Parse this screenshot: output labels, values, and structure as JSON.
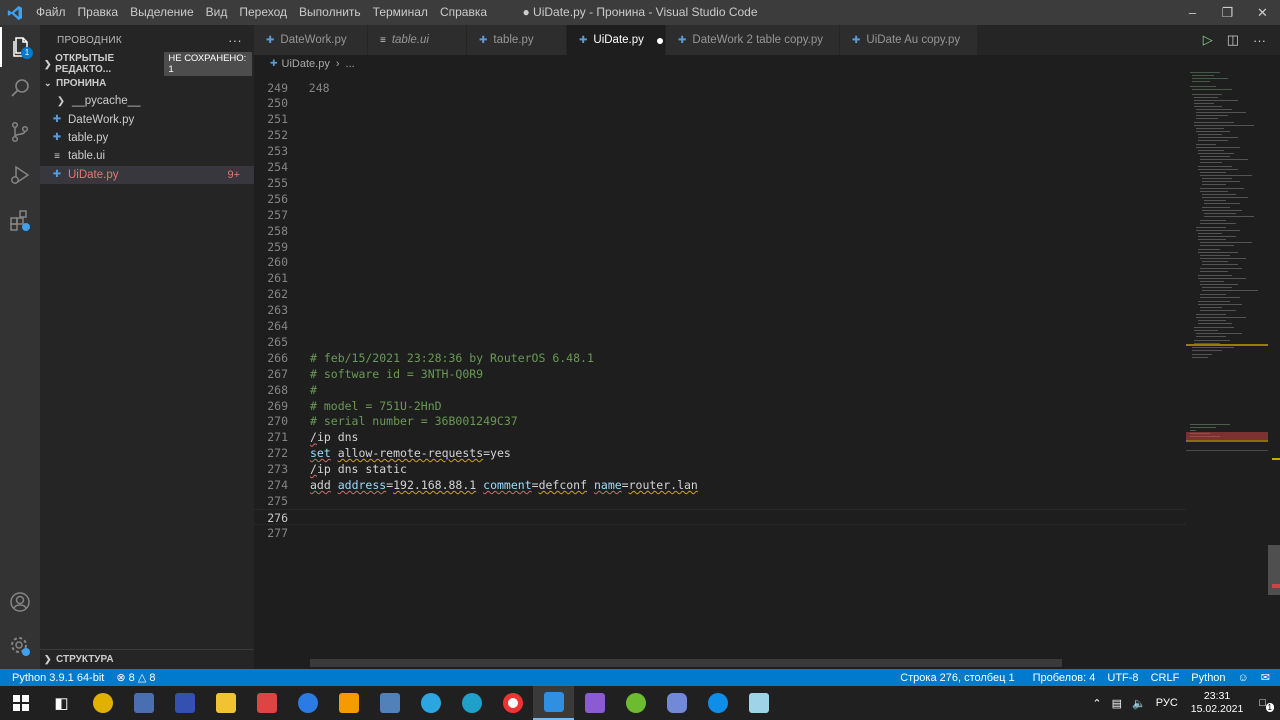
{
  "window": {
    "title": "● UiDate.py - Пронина - Visual Studio Code",
    "menu": [
      "Файл",
      "Правка",
      "Выделение",
      "Вид",
      "Переход",
      "Выполнить",
      "Терминал",
      "Справка"
    ]
  },
  "sidebar": {
    "title": "ПРОВОДНИК",
    "more": "···",
    "open_editors": "ОТКРЫТЫЕ РЕДАКТО...",
    "unsaved_badge": "НЕ СОХРАНЕНО: 1",
    "folder": "ПРОНИНА",
    "items": [
      {
        "label": "__pycache__",
        "type": "folder"
      },
      {
        "label": "DateWork.py",
        "type": "py"
      },
      {
        "label": "table.py",
        "type": "py"
      },
      {
        "label": "table.ui",
        "type": "ui"
      },
      {
        "label": "UiDate.py",
        "type": "py",
        "badge": "9+"
      }
    ],
    "outline": "СТРУКТУРА"
  },
  "tabs": [
    {
      "label": "DateWork.py",
      "icon": "python-icon"
    },
    {
      "label": "table.ui",
      "icon": "lines-icon"
    },
    {
      "label": "table.py",
      "icon": "python-icon"
    },
    {
      "label": "UiDate.py",
      "icon": "python-icon",
      "active": true
    },
    {
      "label": "DateWork 2 table copy.py",
      "icon": "python-icon"
    },
    {
      "label": "UiDate Au copy.py",
      "icon": "python-icon"
    }
  ],
  "breadcrumb": {
    "file": "UiDate.py",
    "sep": "›",
    "rest": "..."
  },
  "code": {
    "partial_line": "248",
    "lines": [
      {
        "n": "249",
        "t": ""
      },
      {
        "n": "250",
        "t": ""
      },
      {
        "n": "251",
        "t": ""
      },
      {
        "n": "252",
        "t": ""
      },
      {
        "n": "253",
        "t": ""
      },
      {
        "n": "254",
        "t": ""
      },
      {
        "n": "255",
        "t": ""
      },
      {
        "n": "256",
        "t": ""
      },
      {
        "n": "257",
        "t": ""
      },
      {
        "n": "258",
        "t": ""
      },
      {
        "n": "259",
        "t": ""
      },
      {
        "n": "260",
        "t": ""
      },
      {
        "n": "261",
        "t": ""
      },
      {
        "n": "262",
        "t": ""
      },
      {
        "n": "263",
        "t": ""
      },
      {
        "n": "264",
        "t": ""
      },
      {
        "n": "265",
        "t": ""
      },
      {
        "n": "266",
        "t": "# feb/15/2021 23:28:36 by RouterOS 6.48.1"
      },
      {
        "n": "267",
        "t": "# software id = 3NTH-Q0R9"
      },
      {
        "n": "268",
        "t": "#"
      },
      {
        "n": "269",
        "t": "# model = 751U-2HnD"
      },
      {
        "n": "270",
        "t": "# serial number = 36B001249C37"
      },
      {
        "n": "271",
        "t": "/ip dns"
      },
      {
        "n": "272",
        "t": "set allow-remote-requests=yes"
      },
      {
        "n": "273",
        "t": "/ip dns static"
      },
      {
        "n": "274",
        "t": "add address=192.168.88.1 comment=defconf name=router.lan"
      },
      {
        "n": "275",
        "t": ""
      },
      {
        "n": "276",
        "t": ""
      },
      {
        "n": "277",
        "t": ""
      }
    ]
  },
  "status": {
    "interpreter": "Python 3.9.1 64-bit",
    "errors": "8",
    "warnings": "8",
    "position": "Строка 276, столбец 1",
    "spaces": "Пробелов: 4",
    "encoding": "UTF-8",
    "eol": "CRLF",
    "language": "Python"
  },
  "taskbar": {
    "apps": [
      "windows-start",
      "task-view",
      "app-a",
      "save-app",
      "calculator-app",
      "file-explorer",
      "mail-app",
      "mail-at-app",
      "mail-envelope-app",
      "vk-app",
      "telegram-app",
      "edge-app",
      "yandex-app",
      "vscode-app",
      "visual-studio-app",
      "utorrent-app",
      "discord-app",
      "teamviewer-app",
      "notepad-app"
    ],
    "lang": "РУС",
    "time": "23:31",
    "date": "15.02.2021",
    "notif_count": "1"
  },
  "colors": {
    "accent": "#007acc",
    "comment": "#6a9955",
    "error": "#e57a6f"
  }
}
